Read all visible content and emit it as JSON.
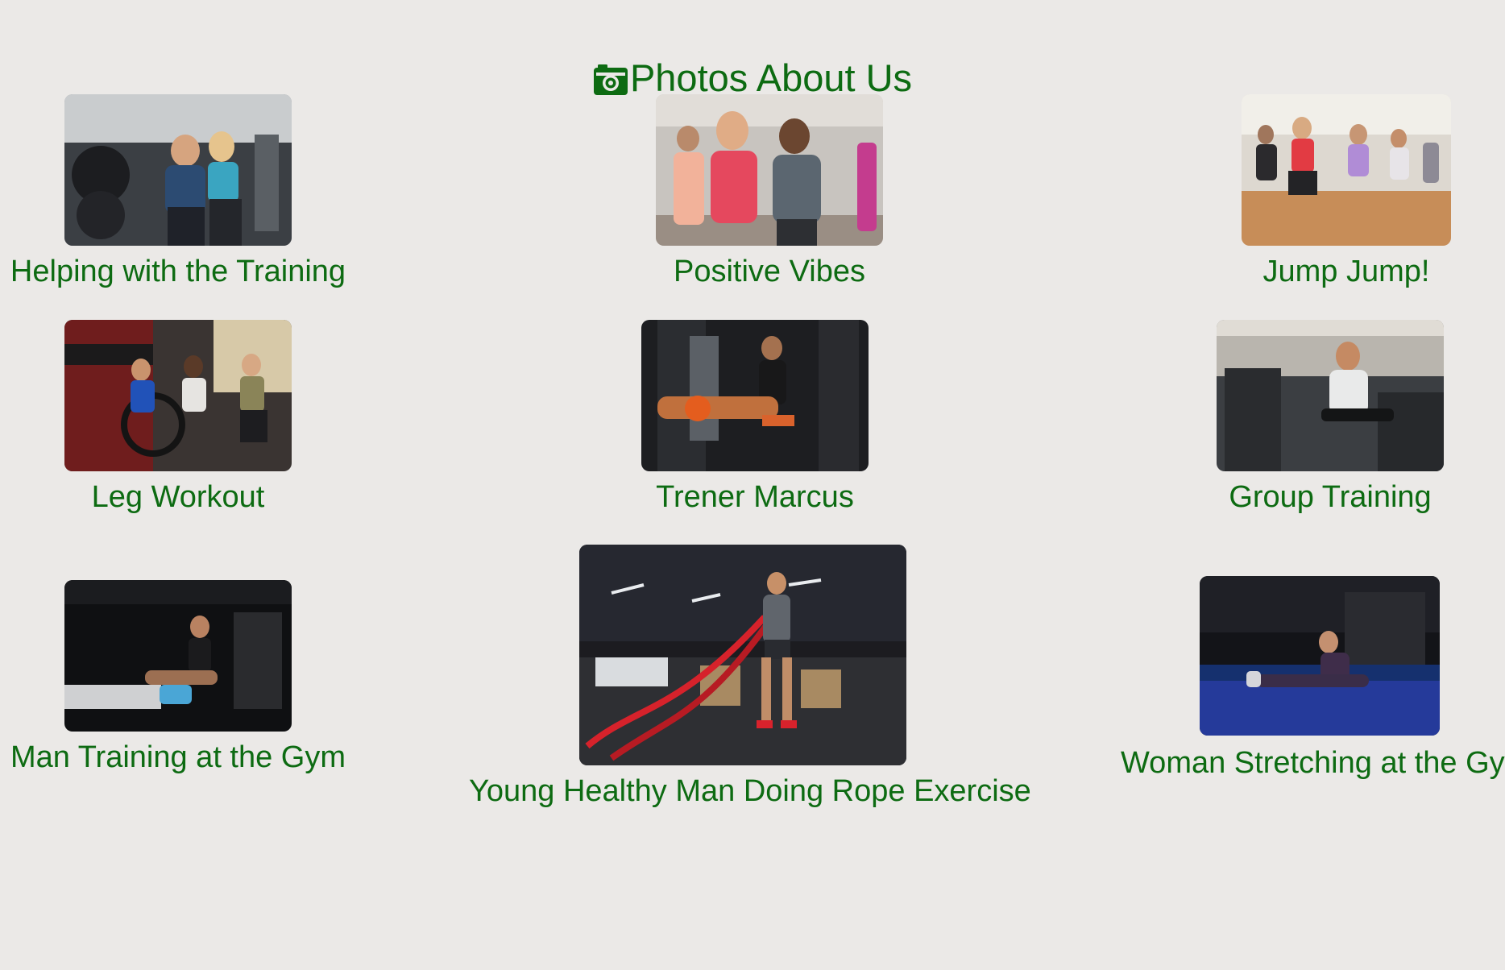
{
  "page": {
    "title": "Photos About Us",
    "title_icon": "camera-icon",
    "accent_color": "#0d6b12",
    "background_color": "#ebe9e7"
  },
  "gallery": {
    "items": [
      {
        "caption": "Helping with the Training",
        "image": "photo-helping-with-training"
      },
      {
        "caption": "Positive Vibes",
        "image": "photo-positive-vibes"
      },
      {
        "caption": "Jump Jump!",
        "image": "photo-jump-jump"
      },
      {
        "caption": "Leg Workout",
        "image": "photo-leg-workout"
      },
      {
        "caption": "Trener Marcus",
        "image": "photo-trener-marcus"
      },
      {
        "caption": "Group Training",
        "image": "photo-group-training"
      },
      {
        "caption": "Man Training at the Gym",
        "image": "photo-man-training"
      },
      {
        "caption": "Young Healthy Man Doing Rope Exercise",
        "image": "photo-rope-exercise"
      },
      {
        "caption": "Woman Stretching at the Gym",
        "image": "photo-woman-stretching"
      }
    ]
  }
}
